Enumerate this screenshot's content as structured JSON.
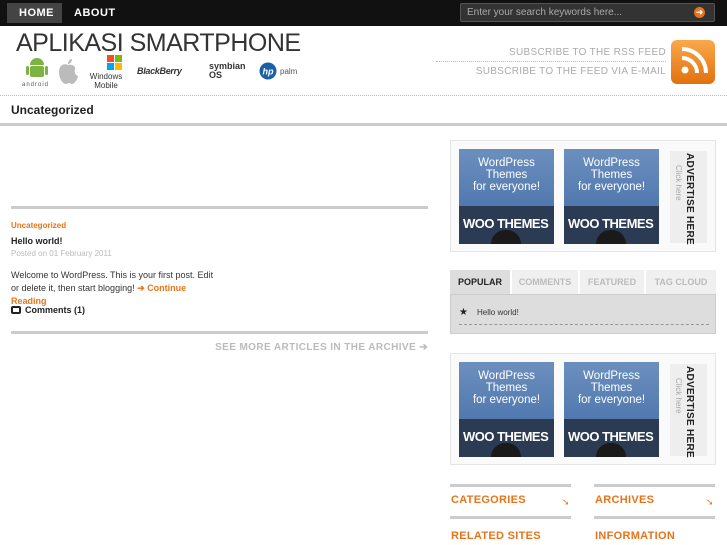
{
  "nav": {
    "home": "HOME",
    "about": "ABOUT"
  },
  "search": {
    "placeholder": "Enter your search keywords here..."
  },
  "header": {
    "logo_title": "APLIKASI SMARTPHONE",
    "platforms": [
      "android",
      "apple",
      "Windows Mobile",
      "BlackBerry",
      "symbian OS",
      "hp palm"
    ],
    "subscribe_rss": "SUBSCRIBE TO THE RSS FEED",
    "subscribe_email": "SUBSCRIBE TO THE FEED VIA E-MAIL"
  },
  "page_title": "Uncategorized",
  "post": {
    "category": "Uncategorized",
    "title": "Hello world!",
    "date": "Posted on 01 February 2011",
    "excerpt": "Welcome to WordPress. This is your first post. Edit or delete it, then start blogging!",
    "continue": "Continue Reading",
    "comments": "Comments (1)"
  },
  "archive_link": "SEE MORE ARTICLES IN THE ARCHIVE",
  "ads": {
    "ad_text_line1": "WordPress",
    "ad_text_line2": "Themes",
    "ad_text_line3": "for everyone!",
    "ad_brand": "WOO THEMES",
    "advertise_here": "ADVERTISE HERE",
    "click_here": "Click here"
  },
  "tabs": {
    "items": [
      "POPULAR",
      "COMMENTS",
      "FEATURED",
      "TAG CLOUD"
    ],
    "active_entry": "Hello world!"
  },
  "widgets": {
    "categories": "CATEGORIES",
    "archives": "ARCHIVES",
    "related_sites": "RELATED SITES",
    "information": "INFORMATION"
  },
  "colors": {
    "accent": "#e8741a",
    "nav_bg": "#111111"
  }
}
